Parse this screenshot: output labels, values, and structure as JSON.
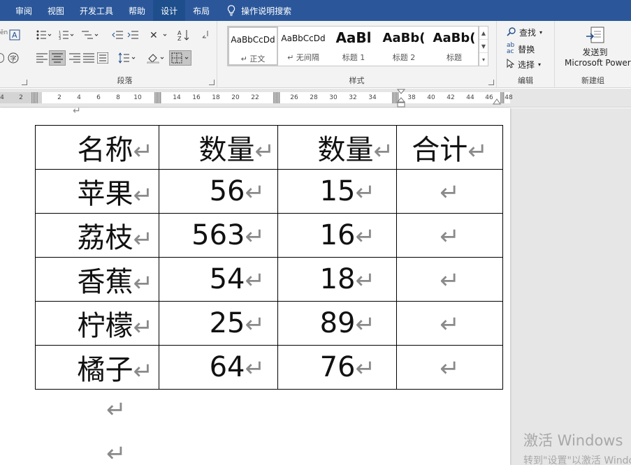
{
  "ribbon_tabs": [
    {
      "label": "审阅"
    },
    {
      "label": "视图"
    },
    {
      "label": "开发工具"
    },
    {
      "label": "帮助"
    },
    {
      "label": "设计",
      "active": true
    },
    {
      "label": "布局"
    }
  ],
  "tell_me": {
    "label": "操作说明搜索",
    "icon": "lightbulb-icon"
  },
  "groups": {
    "paragraph": {
      "label": "段落"
    },
    "styles": {
      "label": "样式"
    },
    "editing": {
      "label": "编辑"
    },
    "new_group": {
      "label": "新建组"
    }
  },
  "styles_gallery": [
    {
      "sample": "AaBbCcDd",
      "name": "↵ 正文",
      "selected": true
    },
    {
      "sample": "AaBbCcDd",
      "name": "↵ 无间隔"
    },
    {
      "sample": "AaBl",
      "name": "标题 1"
    },
    {
      "sample": "AaBb(",
      "name": "标题 2"
    },
    {
      "sample": "AaBb(",
      "name": "标题"
    }
  ],
  "editing": {
    "find": "查找",
    "replace": "替换",
    "select": "选择"
  },
  "send_to": {
    "line1": "发送到",
    "line2": "Microsoft Power"
  },
  "ruler": {
    "labels": [
      "4",
      "2",
      "2",
      "4",
      "6",
      "8",
      "10",
      "14",
      "16",
      "18",
      "20",
      "22",
      "26",
      "28",
      "30",
      "32",
      "34",
      "38",
      "40",
      "42",
      "44",
      "46",
      "48"
    ]
  },
  "table": {
    "headers": [
      "名称",
      "数量",
      "数量",
      "合计"
    ],
    "rows": [
      [
        "苹果",
        "56",
        "15",
        ""
      ],
      [
        "荔枝",
        "563",
        "16",
        ""
      ],
      [
        "香蕉",
        "54",
        "18",
        ""
      ],
      [
        "柠檬",
        "25",
        "89",
        ""
      ],
      [
        "橘子",
        "64",
        "76",
        ""
      ]
    ],
    "cell_end_mark": "↵"
  },
  "paragraph_mark": "↵",
  "watermark": {
    "line1": "激活 Windows",
    "line2": "转到\"设置\"以激活 Windows"
  },
  "colors": {
    "ribbon_blue": "#2b579a",
    "ribbon_bg": "#f3f3f3",
    "para_mark": "#8a8a8a"
  }
}
